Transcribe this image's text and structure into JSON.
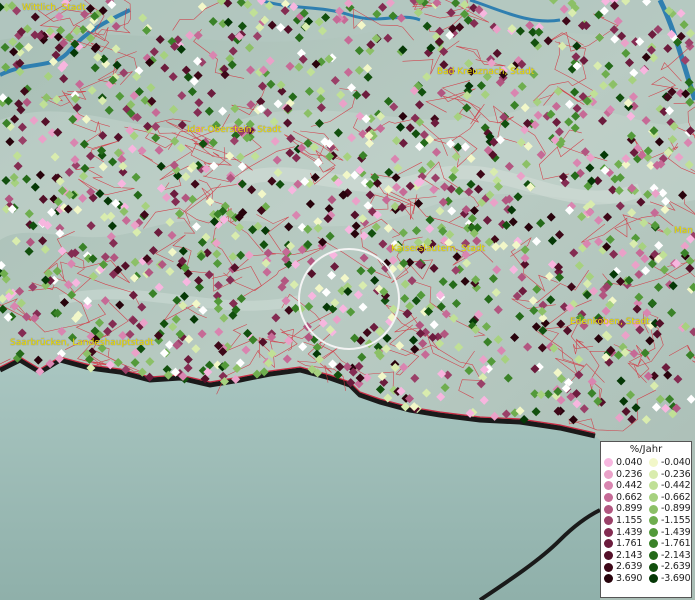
{
  "map": {
    "cities": [
      {
        "name": "Wittlich, Stadt"
      },
      {
        "name": "Bad Kreuznach, Stadt"
      },
      {
        "name": "Idar-Oberstein, Stadt"
      },
      {
        "name": "Kaiserslautern, Stadt"
      },
      {
        "name": "Man"
      },
      {
        "name": "Edenkoben, Stadt"
      },
      {
        "name": "Saarbrücken, Landeshauptstadt"
      }
    ]
  },
  "legend": {
    "title": "%/Jahr",
    "rows": [
      {
        "pos": "0.040",
        "neg": "-0.040",
        "pos_color": "#f7b6df",
        "neg_color": "#f2f7c8"
      },
      {
        "pos": "0.236",
        "neg": "-0.236",
        "pos_color": "#eaa1c8",
        "neg_color": "#d9ecae"
      },
      {
        "pos": "0.442",
        "neg": "-0.442",
        "pos_color": "#d985b0",
        "neg_color": "#c0e096"
      },
      {
        "pos": "0.662",
        "neg": "-0.662",
        "pos_color": "#c66a96",
        "neg_color": "#a6d17f"
      },
      {
        "pos": "0.899",
        "neg": "-0.899",
        "pos_color": "#b25680",
        "neg_color": "#8cc067"
      },
      {
        "pos": "1.155",
        "neg": "-1.155",
        "pos_color": "#9a4068",
        "neg_color": "#6fae4f"
      },
      {
        "pos": "1.439",
        "neg": "-1.439",
        "pos_color": "#842c52",
        "neg_color": "#539a3a"
      },
      {
        "pos": "1.761",
        "neg": "-1.761",
        "pos_color": "#6c1c3d",
        "neg_color": "#3a8228"
      },
      {
        "pos": "2.143",
        "neg": "-2.143",
        "pos_color": "#541029",
        "neg_color": "#246a19"
      },
      {
        "pos": "2.639",
        "neg": "-2.639",
        "pos_color": "#3e0818",
        "neg_color": "#12500e"
      },
      {
        "pos": "3.690",
        "neg": "-3.690",
        "pos_color": "#28030c",
        "neg_color": "#053806"
      }
    ]
  }
}
